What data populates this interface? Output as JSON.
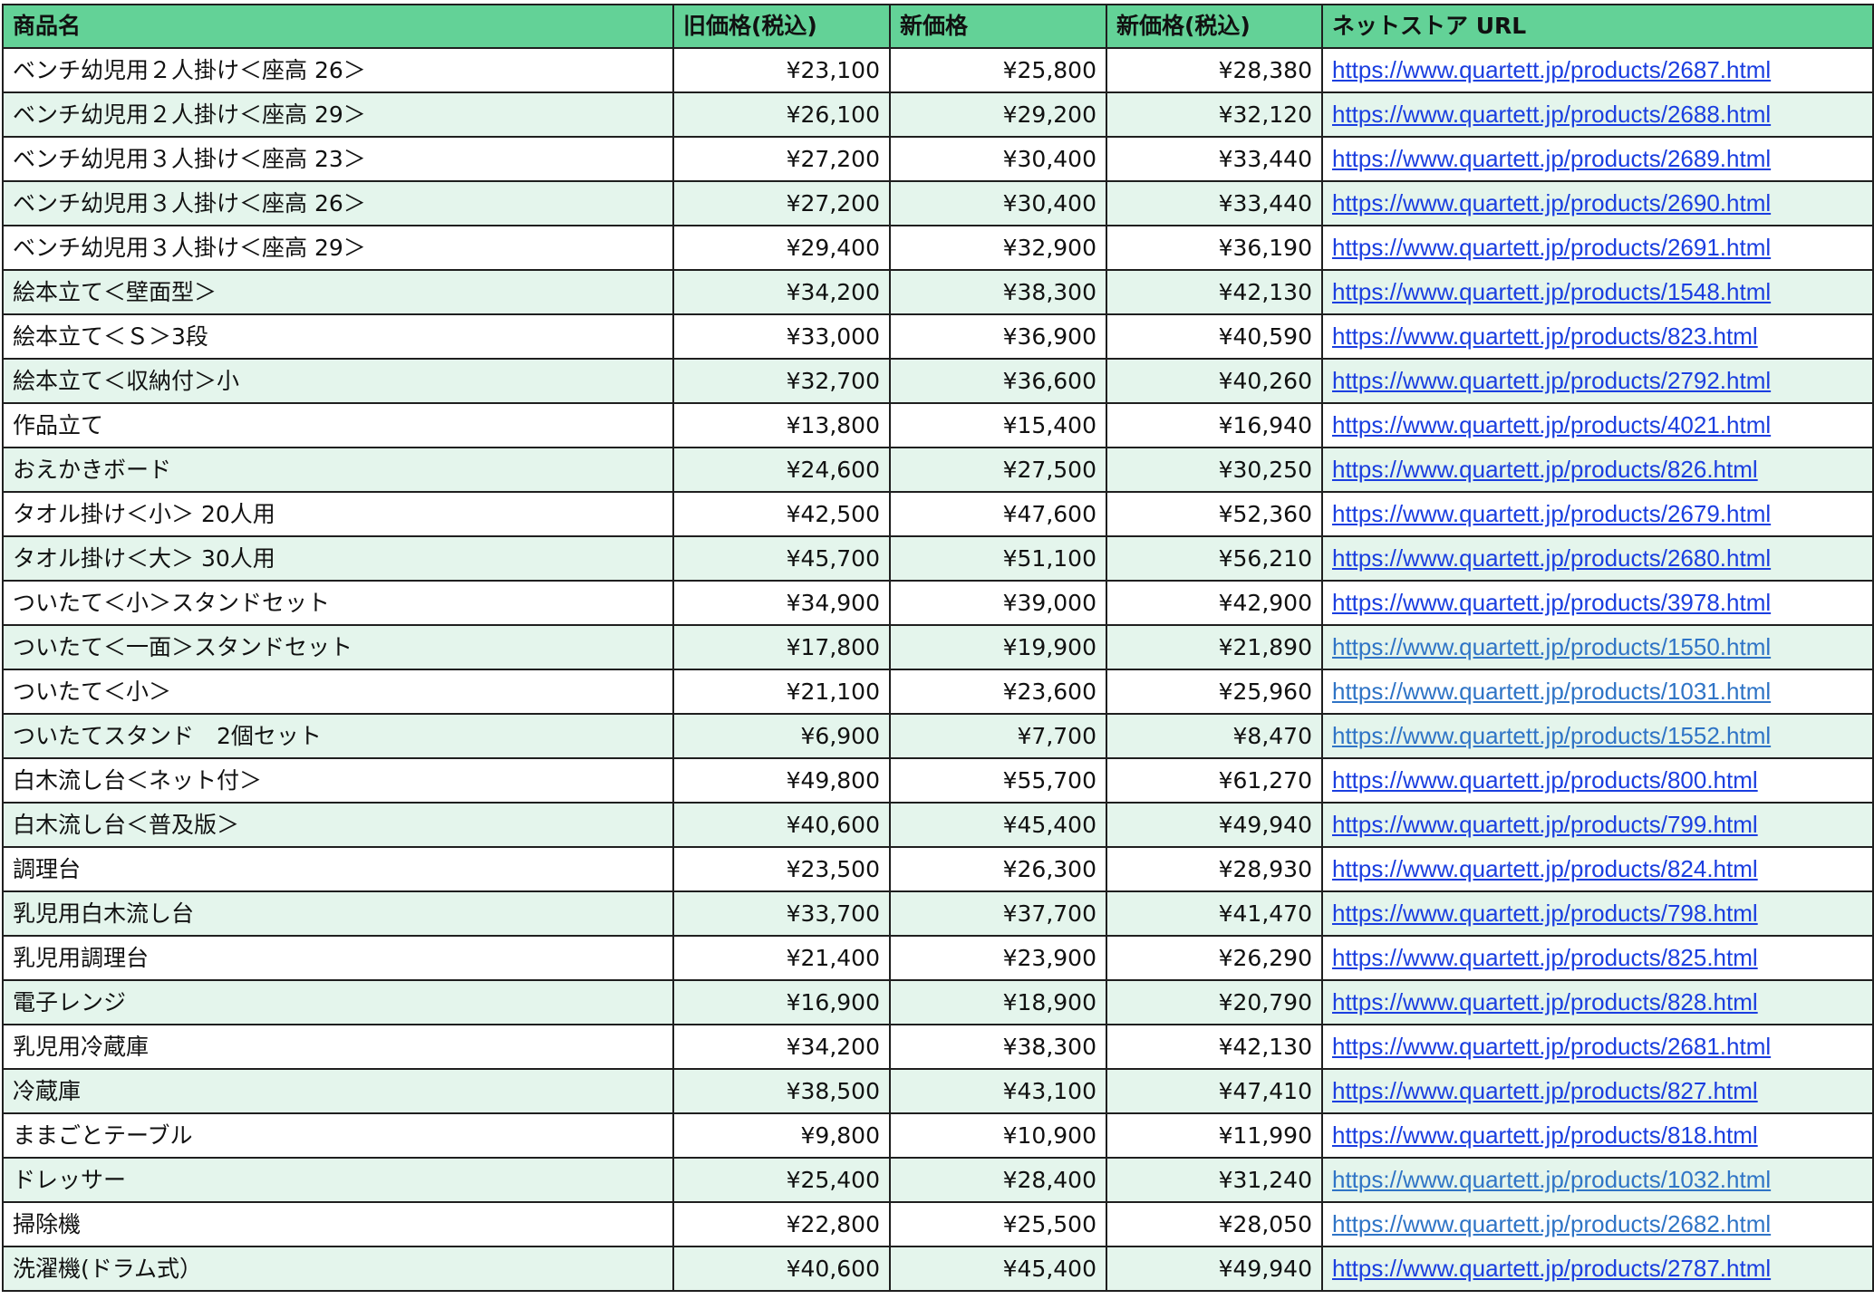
{
  "headers": {
    "name": "商品名",
    "old_price": "旧価格(税込)",
    "new_price": "新価格",
    "new_price_tax": "新価格(税込)",
    "url": "ネットストア URL"
  },
  "colors": {
    "header_bg": "#63d297",
    "stripe_bg": "#e4f5ec",
    "link": "#1a3ee0",
    "link_light": "#2f74c6"
  },
  "rows": [
    {
      "name": "ベンチ幼児用２人掛け＜座高 26＞",
      "old": "¥23,100",
      "new": "¥25,800",
      "tax": "¥28,380",
      "url": "https://www.quartett.jp/products/2687.html",
      "light": false
    },
    {
      "name": "ベンチ幼児用２人掛け＜座高 29＞",
      "old": "¥26,100",
      "new": "¥29,200",
      "tax": "¥32,120",
      "url": "https://www.quartett.jp/products/2688.html",
      "light": false
    },
    {
      "name": "ベンチ幼児用３人掛け＜座高 23＞",
      "old": "¥27,200",
      "new": "¥30,400",
      "tax": "¥33,440",
      "url": "https://www.quartett.jp/products/2689.html",
      "light": false
    },
    {
      "name": "ベンチ幼児用３人掛け＜座高 26＞",
      "old": "¥27,200",
      "new": "¥30,400",
      "tax": "¥33,440",
      "url": "https://www.quartett.jp/products/2690.html",
      "light": false
    },
    {
      "name": "ベンチ幼児用３人掛け＜座高 29＞",
      "old": "¥29,400",
      "new": "¥32,900",
      "tax": "¥36,190",
      "url": "https://www.quartett.jp/products/2691.html",
      "light": false
    },
    {
      "name": "絵本立て＜壁面型＞",
      "old": "¥34,200",
      "new": "¥38,300",
      "tax": "¥42,130",
      "url": "https://www.quartett.jp/products/1548.html",
      "light": false
    },
    {
      "name": "絵本立て＜Ｓ＞3段",
      "old": "¥33,000",
      "new": "¥36,900",
      "tax": "¥40,590",
      "url": "https://www.quartett.jp/products/823.html",
      "light": false
    },
    {
      "name": "絵本立て＜収納付＞小",
      "old": "¥32,700",
      "new": "¥36,600",
      "tax": "¥40,260",
      "url": "https://www.quartett.jp/products/2792.html",
      "light": false
    },
    {
      "name": "作品立て",
      "old": "¥13,800",
      "new": "¥15,400",
      "tax": "¥16,940",
      "url": "https://www.quartett.jp/products/4021.html",
      "light": false
    },
    {
      "name": "おえかきボード",
      "old": "¥24,600",
      "new": "¥27,500",
      "tax": "¥30,250",
      "url": "https://www.quartett.jp/products/826.html",
      "light": false
    },
    {
      "name": "タオル掛け＜小＞ 20人用",
      "old": "¥42,500",
      "new": "¥47,600",
      "tax": "¥52,360",
      "url": "https://www.quartett.jp/products/2679.html",
      "light": false
    },
    {
      "name": "タオル掛け＜大＞ 30人用",
      "old": "¥45,700",
      "new": "¥51,100",
      "tax": "¥56,210",
      "url": "https://www.quartett.jp/products/2680.html",
      "light": false
    },
    {
      "name": "ついたて＜小＞スタンドセット",
      "old": "¥34,900",
      "new": "¥39,000",
      "tax": "¥42,900",
      "url": "https://www.quartett.jp/products/3978.html",
      "light": false
    },
    {
      "name": "ついたて＜一面＞スタンドセット",
      "old": "¥17,800",
      "new": "¥19,900",
      "tax": "¥21,890",
      "url": "https://www.quartett.jp/products/1550.html",
      "light": true
    },
    {
      "name": "ついたて＜小＞",
      "old": "¥21,100",
      "new": "¥23,600",
      "tax": "¥25,960",
      "url": "https://www.quartett.jp/products/1031.html",
      "light": true
    },
    {
      "name": "ついたてスタンド　2個セット",
      "old": "¥6,900",
      "new": "¥7,700",
      "tax": "¥8,470",
      "url": "https://www.quartett.jp/products/1552.html",
      "light": true
    },
    {
      "name": "白木流し台＜ネット付＞",
      "old": "¥49,800",
      "new": "¥55,700",
      "tax": "¥61,270",
      "url": "https://www.quartett.jp/products/800.html",
      "light": false
    },
    {
      "name": "白木流し台＜普及版＞",
      "old": "¥40,600",
      "new": "¥45,400",
      "tax": "¥49,940",
      "url": "https://www.quartett.jp/products/799.html",
      "light": false
    },
    {
      "name": "調理台",
      "old": "¥23,500",
      "new": "¥26,300",
      "tax": "¥28,930",
      "url": "https://www.quartett.jp/products/824.html",
      "light": false
    },
    {
      "name": "乳児用白木流し台",
      "old": "¥33,700",
      "new": "¥37,700",
      "tax": "¥41,470",
      "url": "https://www.quartett.jp/products/798.html",
      "light": false
    },
    {
      "name": "乳児用調理台",
      "old": "¥21,400",
      "new": "¥23,900",
      "tax": "¥26,290",
      "url": "https://www.quartett.jp/products/825.html",
      "light": false
    },
    {
      "name": "電子レンジ",
      "old": "¥16,900",
      "new": "¥18,900",
      "tax": "¥20,790",
      "url": "https://www.quartett.jp/products/828.html",
      "light": false
    },
    {
      "name": "乳児用冷蔵庫",
      "old": "¥34,200",
      "new": "¥38,300",
      "tax": "¥42,130",
      "url": "https://www.quartett.jp/products/2681.html",
      "light": false
    },
    {
      "name": "冷蔵庫",
      "old": "¥38,500",
      "new": "¥43,100",
      "tax": "¥47,410",
      "url": "https://www.quartett.jp/products/827.html",
      "light": false
    },
    {
      "name": "ままごとテーブル",
      "old": "¥9,800",
      "new": "¥10,900",
      "tax": "¥11,990",
      "url": "https://www.quartett.jp/products/818.html",
      "light": false
    },
    {
      "name": "ドレッサー",
      "old": "¥25,400",
      "new": "¥28,400",
      "tax": "¥31,240",
      "url": "https://www.quartett.jp/products/1032.html",
      "light": true
    },
    {
      "name": "掃除機",
      "old": "¥22,800",
      "new": "¥25,500",
      "tax": "¥28,050",
      "url": "https://www.quartett.jp/products/2682.html",
      "light": true
    },
    {
      "name": "洗濯機(ドラム式）",
      "old": "¥40,600",
      "new": "¥45,400",
      "tax": "¥49,940",
      "url": "https://www.quartett.jp/products/2787.html",
      "light": false
    }
  ]
}
